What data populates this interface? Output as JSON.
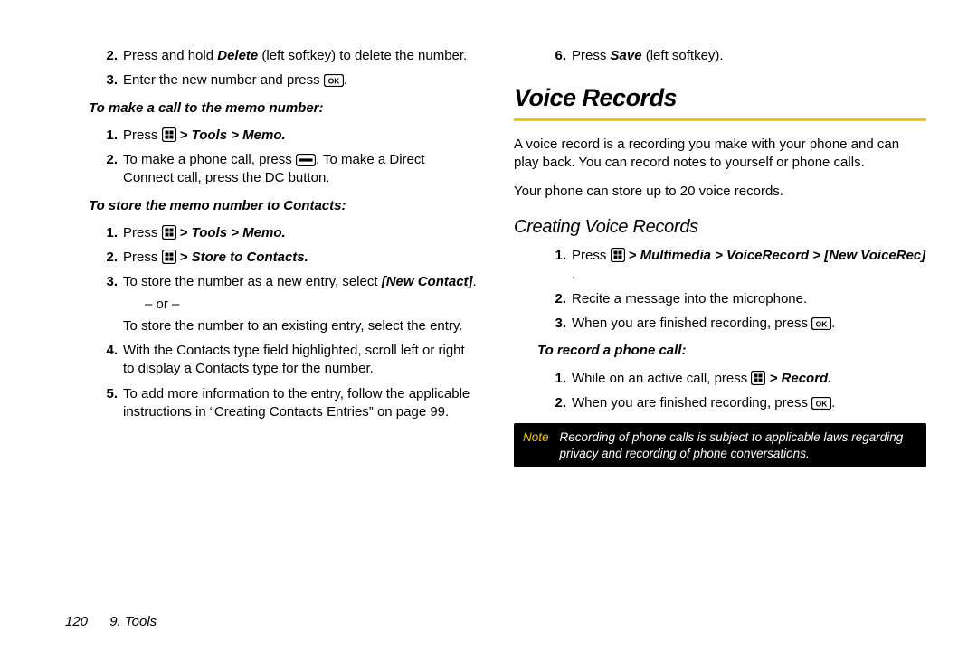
{
  "left": {
    "step2": {
      "pre": "Press and hold ",
      "b": "Delete",
      "post": " (left softkey) to delete the number."
    },
    "step3": "Enter the new number and press ",
    "h_call": "To make a call to the memo number:",
    "call1": {
      "a": "Press ",
      "b": " > Tools > Memo."
    },
    "call2": {
      "a": "To make a phone call, press ",
      "b": ". To make a Direct Connect call, press the DC button."
    },
    "h_store": "To store the memo number to Contacts:",
    "st1": {
      "a": "Press ",
      "b": " > Tools > Memo."
    },
    "st2": {
      "a": "Press ",
      "b": " > Store to Contacts."
    },
    "st3": {
      "a": "To store the number as a new entry, select ",
      "b": "[New Contact]",
      "c": ".",
      "or": "– or –",
      "d": "To store the number to an existing entry, select the entry."
    },
    "st4": "With the Contacts type field highlighted, scroll left or right to display a Contacts type for the number.",
    "st5": "To add more information to the entry, follow the applicable instructions in “Creating Contacts Entries” on page 99."
  },
  "right": {
    "step6": {
      "a": "Press ",
      "b": "Save",
      "c": " (left softkey)."
    },
    "h1": "Voice Records",
    "p1": "A voice record is a recording you make with your phone and can play back. You can record notes to yourself or phone calls.",
    "p2": "Your phone can store up to 20 voice records.",
    "h2": "Creating Voice Records",
    "cv1": {
      "a": "Press ",
      "b": " > Multimedia > VoiceRecord > [New VoiceRec]",
      "c": " ."
    },
    "cv2": "Recite a message into the microphone.",
    "cv3": "When you are finished recording, press ",
    "h_rec": "To record a phone call:",
    "rc1": {
      "a": "While on an active call, press ",
      "b": " > Record."
    },
    "rc2": "When you are finished recording, press ",
    "note_label": "Note",
    "note_text": "Recording of phone calls is subject to applicable laws regarding privacy and recording of phone conversations."
  },
  "footer": {
    "page": "120",
    "section": "9. Tools"
  }
}
